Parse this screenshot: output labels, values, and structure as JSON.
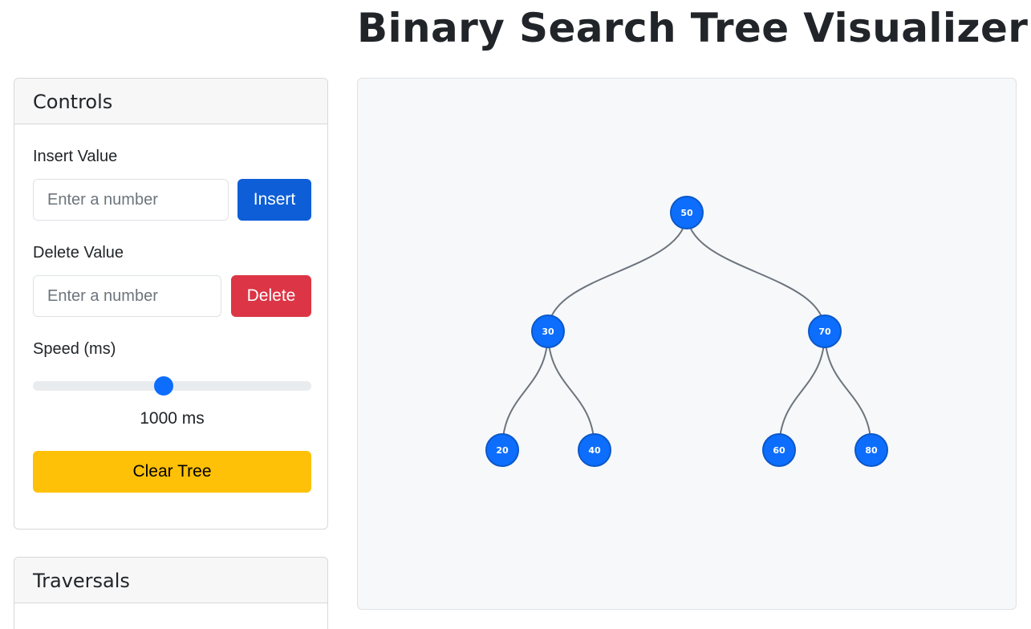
{
  "page": {
    "title": "Binary Search Tree Visualizer"
  },
  "controls": {
    "header": "Controls",
    "insert_label": "Insert Value",
    "insert_placeholder": "Enter a number",
    "insert_button": "Insert",
    "delete_label": "Delete Value",
    "delete_placeholder": "Enter a number",
    "delete_button": "Delete",
    "speed_label": "Speed (ms)",
    "speed_value_text": "1000 ms",
    "speed_fraction": 0.47,
    "clear_button": "Clear Tree"
  },
  "traversals": {
    "header": "Traversals"
  },
  "tree": {
    "nodes": [
      {
        "id": "n50",
        "value": "50",
        "depth": 0,
        "order": 3
      },
      {
        "id": "n30",
        "value": "30",
        "depth": 1,
        "order": 1
      },
      {
        "id": "n70",
        "value": "70",
        "depth": 1,
        "order": 5
      },
      {
        "id": "n20",
        "value": "20",
        "depth": 2,
        "order": 0
      },
      {
        "id": "n40",
        "value": "40",
        "depth": 2,
        "order": 2
      },
      {
        "id": "n60",
        "value": "60",
        "depth": 2,
        "order": 4
      },
      {
        "id": "n80",
        "value": "80",
        "depth": 2,
        "order": 6
      }
    ],
    "edges": [
      [
        "n50",
        "n30"
      ],
      [
        "n50",
        "n70"
      ],
      [
        "n30",
        "n20"
      ],
      [
        "n30",
        "n40"
      ],
      [
        "n70",
        "n60"
      ],
      [
        "n70",
        "n80"
      ]
    ]
  },
  "colors": {
    "node_fill": "#0d6efd",
    "primary": "#0d5ed7",
    "danger": "#dc3545",
    "warning": "#ffc107"
  }
}
